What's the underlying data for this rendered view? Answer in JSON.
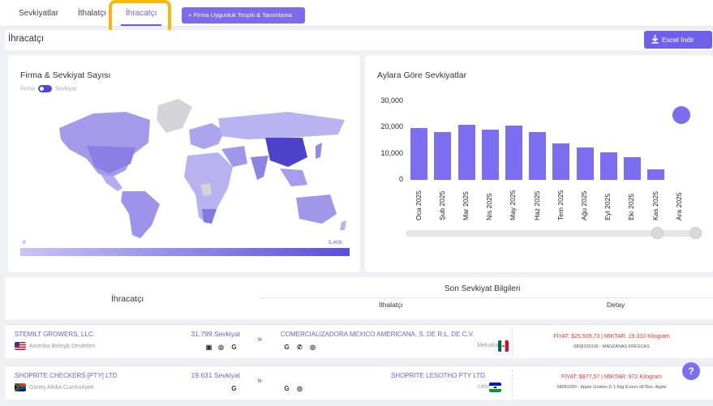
{
  "tabs": [
    {
      "label": "Sevkiyatlar"
    },
    {
      "label": "İthalatçı"
    },
    {
      "label": "İhracatçı"
    }
  ],
  "add_firm_label": "+ Firma Uygunluk Tespiti & Tanımlama",
  "page_title": "İhracatçı",
  "excel_label": "Excel İndir",
  "map_card": {
    "title": "Firma & Sevkiyat Sayısı",
    "toggle_left": "Firma",
    "toggle_right": "Sevkiyat",
    "legend_min": "0",
    "legend_max": "5,408"
  },
  "chart_data": {
    "type": "bar",
    "title": "Aylara Göre Sevkiyatlar",
    "categories": [
      "Oca 2025",
      "Şub 2025",
      "Mar 2025",
      "Nis 2025",
      "May 2025",
      "Haz 2025",
      "Tem 2025",
      "Ağu 2025",
      "Eyl 2025",
      "Eki 2025",
      "Kas 2025",
      "Ara 2025"
    ],
    "values": [
      19700,
      18100,
      20900,
      19100,
      20600,
      18300,
      13900,
      12500,
      10600,
      8800,
      4000,
      0
    ],
    "yticks": [
      "0",
      "10,000",
      "20,000",
      "30,000"
    ],
    "ylim": [
      0,
      30000
    ],
    "grid": false,
    "color": "#7b6ef0"
  },
  "table": {
    "col_exporter": "İhracatçı",
    "col_last": "Son Sevkiyat Bilgileri",
    "col_importer": "İthalatçı",
    "col_detail": "Detay",
    "rows": [
      {
        "exporter": "STEMILT GROWERS, LLC.",
        "exporter_country": "Amerika Birleşik Devletleri",
        "shipments": "31.799 Sevkiyat",
        "importer": "COMERCIALIZADORA MEXICO AMERICANA, S. DE R.L. DE C.V.",
        "importer_country": "Meksika",
        "price": "FİYAT: $25.509,73 | MİKTAR: 19.310 Kilogram",
        "product": "0808100100 - MANZANAS FRESCAS"
      },
      {
        "exporter": "SHOPRITE CHECKERS [PTY] LTD",
        "exporter_country": "Güney Afrika Cumhuriyeti",
        "shipments": "19.631 Sevkiyat",
        "importer": "SHOPRITE LESOTHO PTY LTD.",
        "importer_country": "Lesotho",
        "price": "FİYAT: $977,57 | MİKTAR: 972 Kilogram",
        "product": "08081000 - Apple Golden D 1.5kg Econo x8 Box, Apple"
      }
    ]
  },
  "help_label": "?"
}
